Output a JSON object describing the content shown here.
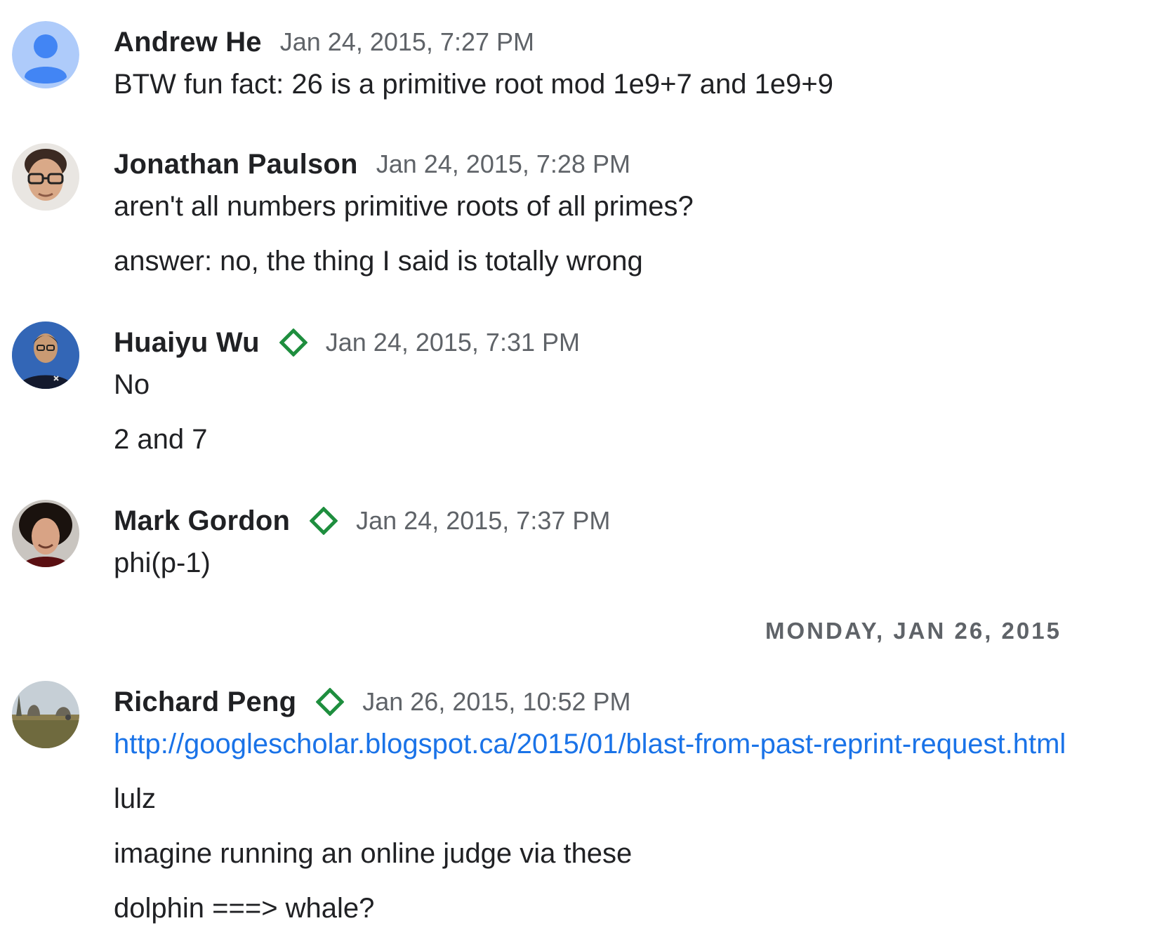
{
  "messages": [
    {
      "author": "Andrew He",
      "timestamp": "Jan 24, 2015, 7:27 PM",
      "lines": [
        "BTW fun fact: 26 is a primitive root mod 1e9+7 and 1e9+9"
      ]
    },
    {
      "author": "Jonathan Paulson",
      "timestamp": "Jan 24, 2015, 7:28 PM",
      "lines": [
        "aren't all numbers primitive roots of all primes?",
        "answer: no, the thing I said is totally wrong"
      ]
    },
    {
      "author": "Huaiyu Wu",
      "timestamp": "Jan 24, 2015, 7:31 PM",
      "lines": [
        "No",
        "2 and 7"
      ]
    },
    {
      "author": "Mark Gordon",
      "timestamp": "Jan 24, 2015, 7:37 PM",
      "lines": [
        "phi(p-1)"
      ]
    },
    {
      "author": "Richard Peng",
      "timestamp": "Jan 26, 2015, 10:52 PM",
      "link": "http://googlescholar.blogspot.ca/2015/01/blast-from-past-reprint-request.html",
      "lines": [
        "lulz",
        "imagine running an online judge via these",
        "dolphin ===> whale?"
      ]
    }
  ],
  "date_divider": "MONDAY, JAN 26, 2015",
  "icons": {
    "badge": "green-diamond-badge-icon",
    "default_avatar": "default-person-avatar-icon"
  },
  "colors": {
    "badge_green": "#1e8e3e",
    "link_blue": "#1a73e8",
    "timestamp_gray": "#5f6368",
    "default_avatar_bg": "#aecbfa",
    "default_avatar_fg": "#4285f4"
  }
}
